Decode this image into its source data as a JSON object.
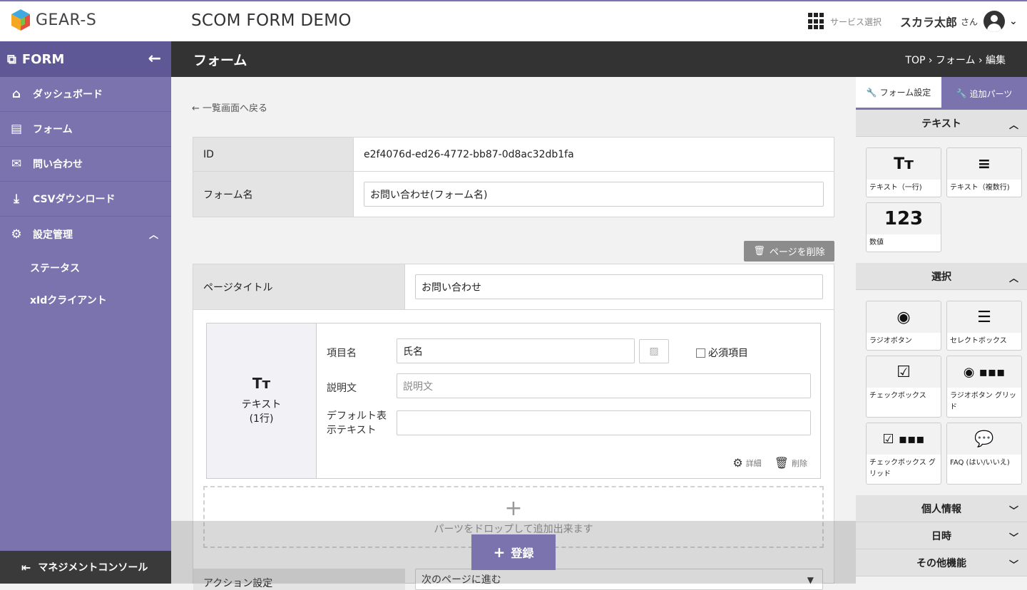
{
  "header": {
    "brand": "GEAR-S",
    "app_title": "SCOM FORM DEMO",
    "service_select": "サービス選択",
    "user_name": "スカラ太郎",
    "user_suffix": "さん"
  },
  "sidebar": {
    "title": "FORM",
    "items": [
      {
        "label": "ダッシュボード",
        "icon": "home-icon"
      },
      {
        "label": "フォーム",
        "icon": "document-icon"
      },
      {
        "label": "問い合わせ",
        "icon": "envelope-icon"
      },
      {
        "label": "CSVダウンロード",
        "icon": "download-icon"
      },
      {
        "label": "設定管理",
        "icon": "gear-icon"
      }
    ],
    "subitems": [
      "ステータス",
      "xIdクライアント"
    ],
    "footer": "マネジメントコンソール"
  },
  "page": {
    "title": "フォーム",
    "breadcrumb": "TOP › フォーム › 編集",
    "back_link": "← 一覧画面へ戻る"
  },
  "form": {
    "id_label": "ID",
    "id_value": "e2f4076d-ed26-4772-bb87-0d8ac32db1fa",
    "name_label": "フォーム名",
    "name_value": "お問い合わせ(フォーム名)",
    "delete_page": "ページを削除",
    "page_title_label": "ページタイトル",
    "page_title_value": "お問い合わせ"
  },
  "part": {
    "icon_text": "Tт",
    "type_label": "テキスト",
    "type_sub": "(1行)",
    "item_name_label": "項目名",
    "item_name_value": "氏名",
    "required_label": "必須項目",
    "desc_label": "説明文",
    "desc_placeholder": "説明文",
    "default_label_1": "デフォルト表",
    "default_label_2": "示テキスト",
    "detail": "詳細",
    "delete": "削除"
  },
  "dropzone": {
    "text": "パーツをドロップして追加出来ます"
  },
  "action": {
    "label": "アクション設定",
    "value": "次のページに進む"
  },
  "save_button": "登録",
  "right_panel": {
    "tab_form_settings": "フォーム設定",
    "tab_add_parts": "追加パーツ",
    "sections": {
      "text": "テキスト",
      "select": "選択",
      "personal": "個人情報",
      "datetime": "日時",
      "other": "その他機能"
    },
    "text_parts": [
      {
        "icon": "Tт",
        "label": "テキスト（一行)"
      },
      {
        "icon": "≡",
        "label": "テキスト（複数行)"
      },
      {
        "icon": "123",
        "label": "数値"
      }
    ],
    "select_parts": [
      {
        "icon": "◉",
        "label": "ラジオボタン"
      },
      {
        "icon": "☰",
        "label": "セレクトボックス"
      },
      {
        "icon": "☑",
        "label": "チェックボックス"
      },
      {
        "icon": "◉ ▪▪▪",
        "label": "ラジオボタン グリッド"
      },
      {
        "icon": "☑ ▪▪▪",
        "label": "チェックボックス グリッド"
      },
      {
        "icon": "💬",
        "label": "FAQ (はい/いいえ)"
      }
    ]
  }
}
